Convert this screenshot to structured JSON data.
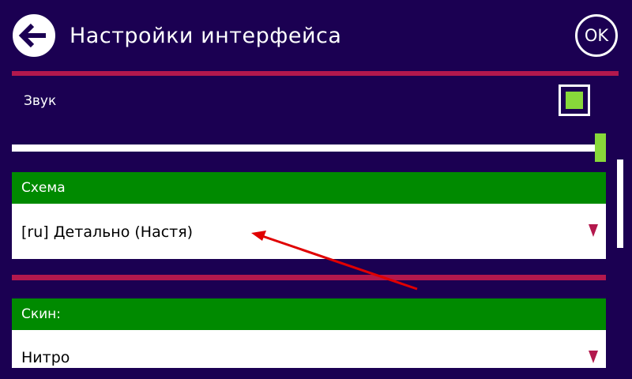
{
  "header": {
    "title": "Настройки интерфейса",
    "ok_label": "OK",
    "back_icon": "arrow-left-circle-icon"
  },
  "sound": {
    "label": "Звук",
    "enabled": true,
    "volume_percent": 100
  },
  "scheme": {
    "header": "Схема",
    "selected": "[ru] Детально (Настя)"
  },
  "skin": {
    "header": "Скин:",
    "selected": "Нитро"
  },
  "colors": {
    "background": "#1b0052",
    "divider": "#b3184d",
    "section_header": "#008a00",
    "accent_green": "#88d83a",
    "dropdown_arrow": "#b3184d",
    "annotation_arrow": "#e00000"
  }
}
